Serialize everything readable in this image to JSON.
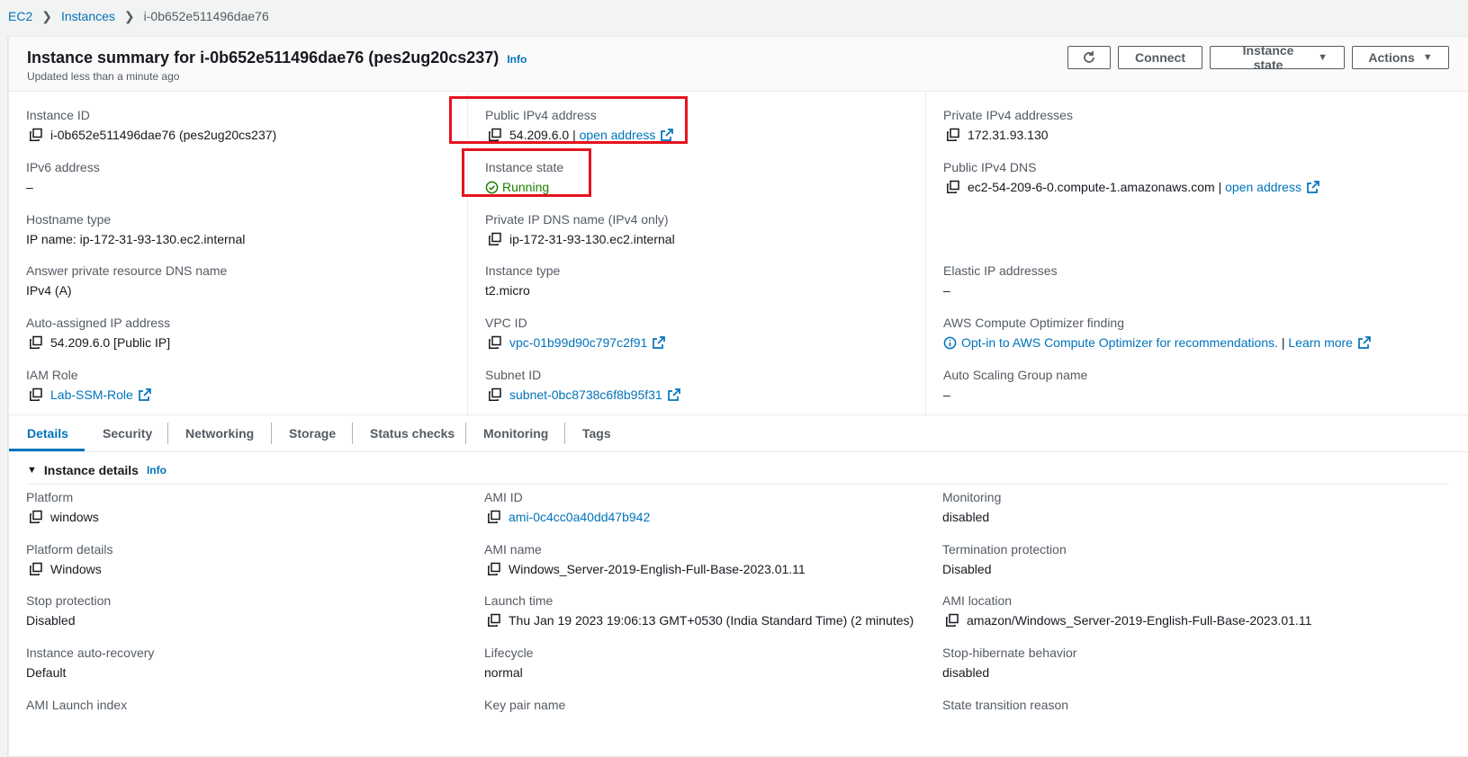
{
  "breadcrumb": {
    "ec2": "EC2",
    "instances": "Instances",
    "current": "i-0b652e511496dae76"
  },
  "header": {
    "title": "Instance summary for i-0b652e511496dae76 (pes2ug20cs237)",
    "info": "Info",
    "updated": "Updated less than a minute ago",
    "buttons": {
      "connect": "Connect",
      "instance_state": "Instance state",
      "actions": "Actions"
    }
  },
  "summary": {
    "instance_id": {
      "label": "Instance ID",
      "value": "i-0b652e511496dae76 (pes2ug20cs237)"
    },
    "public_ipv4": {
      "label": "Public IPv4 address",
      "value": "54.209.6.0",
      "sep": "|",
      "link": "open address"
    },
    "private_ipv4": {
      "label": "Private IPv4 addresses",
      "value": "172.31.93.130"
    },
    "ipv6": {
      "label": "IPv6 address",
      "value": "–"
    },
    "instance_state": {
      "label": "Instance state",
      "value": "Running"
    },
    "public_dns": {
      "label": "Public IPv4 DNS",
      "value": "ec2-54-209-6-0.compute-1.amazonaws.com",
      "sep": "|",
      "link": "open address"
    },
    "hostname_type": {
      "label": "Hostname type",
      "value": "IP name: ip-172-31-93-130.ec2.internal"
    },
    "private_dns": {
      "label": "Private IP DNS name (IPv4 only)",
      "value": "ip-172-31-93-130.ec2.internal"
    },
    "answer_dns": {
      "label": "Answer private resource DNS name",
      "value": "IPv4 (A)"
    },
    "instance_type": {
      "label": "Instance type",
      "value": "t2.micro"
    },
    "elastic_ip": {
      "label": "Elastic IP addresses",
      "value": "–"
    },
    "auto_ip": {
      "label": "Auto-assigned IP address",
      "value": "54.209.6.0 [Public IP]"
    },
    "vpc_id": {
      "label": "VPC ID",
      "value": "vpc-01b99d90c797c2f91"
    },
    "optimizer": {
      "label": "AWS Compute Optimizer finding",
      "value": "Opt-in to AWS Compute Optimizer for recommendations.",
      "sep": "|",
      "link": "Learn more"
    },
    "iam_role": {
      "label": "IAM Role",
      "value": "Lab-SSM-Role"
    },
    "subnet_id": {
      "label": "Subnet ID",
      "value": "subnet-0bc8738c6f8b95f31"
    },
    "asg_name": {
      "label": "Auto Scaling Group name",
      "value": "–"
    }
  },
  "tabs": [
    "Details",
    "Security",
    "Networking",
    "Storage",
    "Status checks",
    "Monitoring",
    "Tags"
  ],
  "details": {
    "section_title": "Instance details",
    "info": "Info",
    "platform": {
      "label": "Platform",
      "value": "windows"
    },
    "ami_id": {
      "label": "AMI ID",
      "value": "ami-0c4cc0a40dd47b942"
    },
    "monitoring": {
      "label": "Monitoring",
      "value": "disabled"
    },
    "platform_details": {
      "label": "Platform details",
      "value": "Windows"
    },
    "ami_name": {
      "label": "AMI name",
      "value": "Windows_Server-2019-English-Full-Base-2023.01.11"
    },
    "termination": {
      "label": "Termination protection",
      "value": "Disabled"
    },
    "stop_protection": {
      "label": "Stop protection",
      "value": "Disabled"
    },
    "launch_time": {
      "label": "Launch time",
      "value": "Thu Jan 19 2023 19:06:13 GMT+0530 (India Standard Time) (2 minutes)"
    },
    "ami_location": {
      "label": "AMI location",
      "value": "amazon/Windows_Server-2019-English-Full-Base-2023.01.11"
    },
    "auto_recovery": {
      "label": "Instance auto-recovery",
      "value": "Default"
    },
    "lifecycle": {
      "label": "Lifecycle",
      "value": "normal"
    },
    "stop_hibernate": {
      "label": "Stop-hibernate behavior",
      "value": "disabled"
    },
    "ami_launch_index": {
      "label": "AMI Launch index"
    },
    "key_pair": {
      "label": "Key pair name"
    },
    "state_reason": {
      "label": "State transition reason"
    }
  },
  "colors": {
    "link": "#0073bb",
    "running": "#1d8102",
    "highlight": "#e5131d"
  }
}
